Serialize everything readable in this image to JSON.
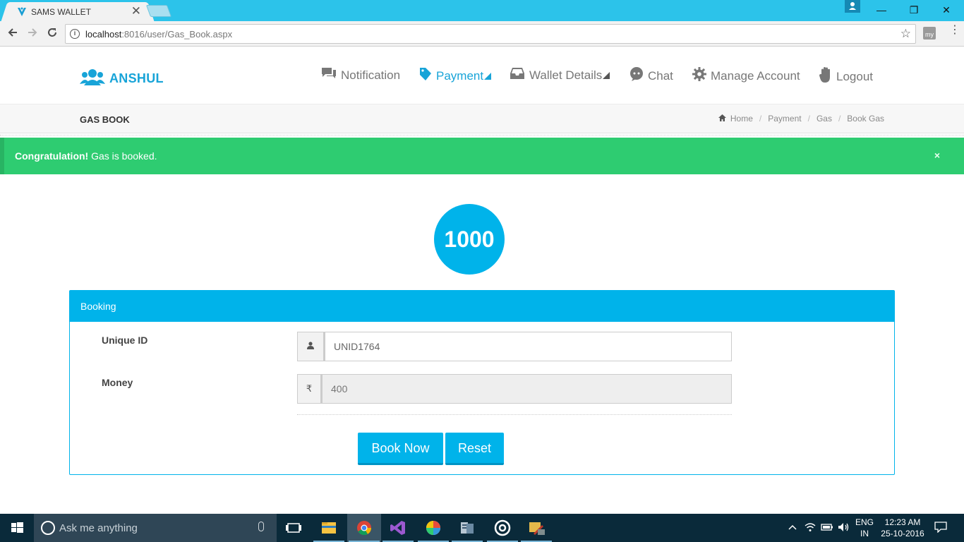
{
  "browser": {
    "tab_title": "SAMS WALLET",
    "tab_close": "✕",
    "url_host": "localhost",
    "url_rest": ":8016/user/Gas_Book.aspx"
  },
  "site": {
    "brand": "ANSHUL",
    "nav": [
      {
        "label": "Notification",
        "icon": "comments-icon"
      },
      {
        "label": "Payment",
        "icon": "tag-icon"
      },
      {
        "label": "Wallet Details",
        "icon": "inbox-icon"
      },
      {
        "label": "Chat",
        "icon": "chat-icon"
      },
      {
        "label": "Manage Account",
        "icon": "gear-icon"
      },
      {
        "label": "Logout",
        "icon": "hand-icon"
      }
    ],
    "accent_color": "#00b3ea",
    "success_color": "#2ecc71"
  },
  "page": {
    "title": "GAS BOOK",
    "breadcrumb": [
      "Home",
      "Payment",
      "Gas",
      "Book Gas"
    ]
  },
  "alert": {
    "strong": "Congratulation!",
    "message": " Gas is booked.",
    "close": "×"
  },
  "balance": "1000",
  "booking": {
    "heading": "Booking",
    "unique_id_label": "Unique ID",
    "unique_id_value": "UNID1764",
    "money_label": "Money",
    "currency_symbol": "₹",
    "money_value": "400",
    "book_button": "Book Now",
    "reset_button": "Reset"
  },
  "taskbar": {
    "search_placeholder": "Ask me anything",
    "lang_top": "ENG",
    "lang_bottom": "IN",
    "time": "12:23 AM",
    "date": "25-10-2016"
  }
}
